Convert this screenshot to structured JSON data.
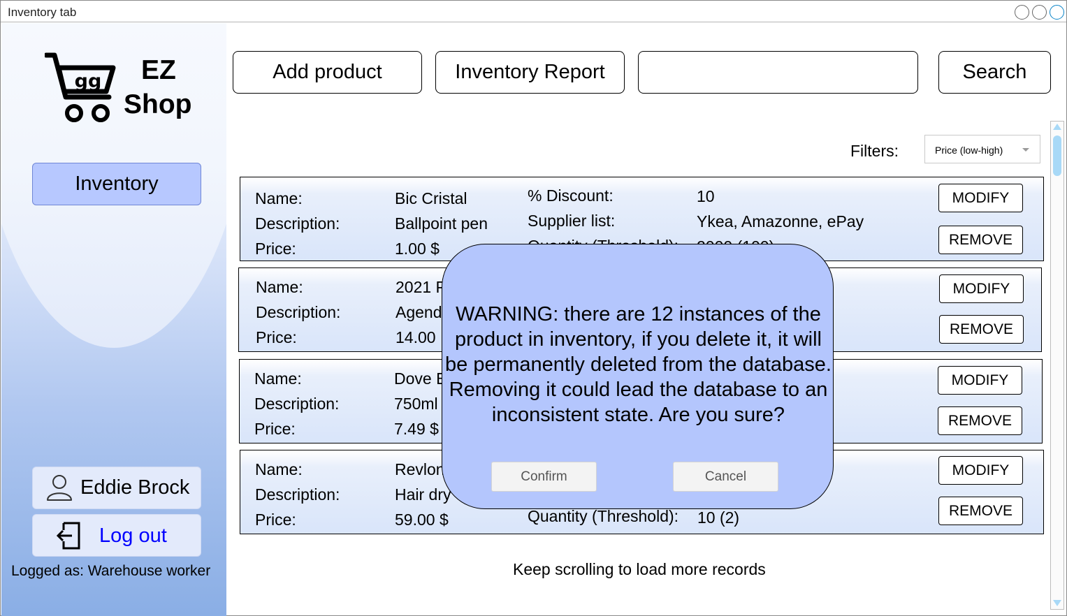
{
  "window": {
    "title": "Inventory tab"
  },
  "brand": {
    "cart_text": "gg",
    "line1": "EZ",
    "line2": "Shop"
  },
  "sidebar": {
    "nav_inventory": "Inventory",
    "user_name": "Eddie Brock",
    "logout": "Log out",
    "logged_as": "Logged as: Warehouse worker"
  },
  "toolbar": {
    "add_product": "Add product",
    "inventory_report": "Inventory Report",
    "search_value": "",
    "search_button": "Search"
  },
  "filters": {
    "label": "Filters:",
    "selected": "Price (low-high)"
  },
  "labels": {
    "name": "Name:",
    "description": "Description:",
    "price": "Price:",
    "discount": "% Discount:",
    "supplier": "Supplier list:",
    "quantity": "Quantity (Threshold):",
    "modify": "MODIFY",
    "remove": "REMOVE"
  },
  "products": [
    {
      "name": "Bic Cristal",
      "description": "Ballpoint pen",
      "price": "1.00 $",
      "discount": "10",
      "suppliers": "Ykea, Amazonne, ePay",
      "quantity": "2000 (100)"
    },
    {
      "name": "2021 P",
      "description": "Agend",
      "price": "14.00",
      "discount": "",
      "suppliers": "",
      "quantity": ""
    },
    {
      "name": "Dove B",
      "description": "750ml",
      "price": "7.49 $",
      "discount": "",
      "suppliers": "",
      "quantity": ""
    },
    {
      "name": "Revlon",
      "description": "Hair dry",
      "price": "59.00 $",
      "discount": "",
      "suppliers": "",
      "quantity": "10 (2)"
    }
  ],
  "footer_note": "Keep scrolling to load more records",
  "modal": {
    "message": "WARNING: there are 12 instances of the product in inventory, if you delete it, it will be permanently deleted from the database. Removing it could lead the database to an inconsistent state. Are you sure?",
    "confirm": "Confirm",
    "cancel": "Cancel"
  },
  "icons": {
    "cart": "shopping-cart-icon",
    "user": "user-icon",
    "logout": "logout-icon",
    "caret": "chevron-down-icon"
  },
  "colors": {
    "nav_active": "#b7c8ff",
    "modal_bg": "#b4c6fd",
    "link": "#0000ff",
    "scroll": "#a8d9f7"
  }
}
